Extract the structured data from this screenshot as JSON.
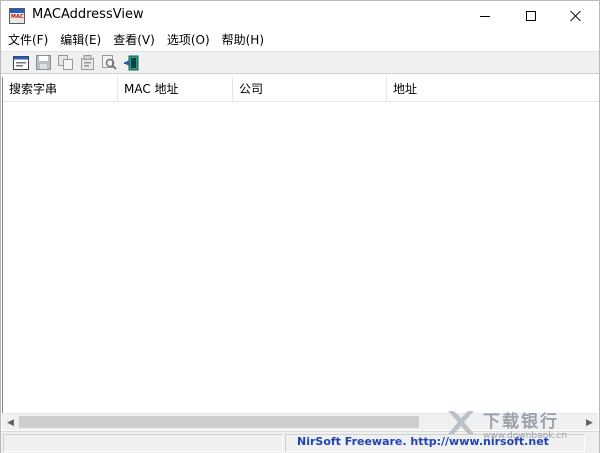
{
  "window": {
    "title": "MACAddressView",
    "icon_text": "MAC"
  },
  "menu": [
    {
      "label": "文件(F)"
    },
    {
      "label": "编辑(E)"
    },
    {
      "label": "查看(V)"
    },
    {
      "label": "选项(O)"
    },
    {
      "label": "帮助(H)"
    }
  ],
  "toolbar": {
    "buttons": [
      "search-properties-icon",
      "save-icon",
      "copy-icon",
      "properties-icon",
      "find-icon",
      "exit-icon"
    ]
  },
  "table": {
    "columns": [
      "搜索字串",
      "MAC 地址",
      "公司",
      "地址"
    ],
    "rows": []
  },
  "status": {
    "link_text": "NirSoft Freeware.  http://www.nirsoft.net"
  },
  "watermark": {
    "title": "下载银行",
    "subtitle": "www.downbank.cn"
  },
  "colors": {
    "link": "#1f44b8",
    "toolbar_bg": "#f0f0f0"
  }
}
